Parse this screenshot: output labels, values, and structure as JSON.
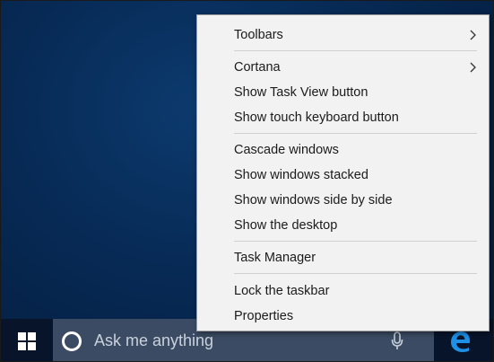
{
  "taskbar": {
    "start_icon": "windows-logo-icon",
    "search": {
      "icon": "cortana-icon",
      "placeholder": "Ask me anything",
      "mic_icon": "microphone-icon"
    },
    "pinned": [
      {
        "icon": "edge-icon",
        "name": "Microsoft Edge"
      }
    ]
  },
  "context_menu": {
    "groups": [
      [
        {
          "label": "Toolbars",
          "submenu": true
        }
      ],
      [
        {
          "label": "Cortana",
          "submenu": true
        },
        {
          "label": "Show Task View button",
          "submenu": false
        },
        {
          "label": "Show touch keyboard button",
          "submenu": false
        }
      ],
      [
        {
          "label": "Cascade windows",
          "submenu": false
        },
        {
          "label": "Show windows stacked",
          "submenu": false
        },
        {
          "label": "Show windows side by side",
          "submenu": false
        },
        {
          "label": "Show the desktop",
          "submenu": false
        }
      ],
      [
        {
          "label": "Task Manager",
          "submenu": false
        }
      ],
      [
        {
          "label": "Lock the taskbar",
          "submenu": false
        },
        {
          "label": "Properties",
          "submenu": false
        }
      ]
    ]
  },
  "colors": {
    "desktop_background": "#072a55",
    "taskbar_background": "#08142a",
    "search_background": "#3b4b63",
    "edge_blue": "#1e90e6",
    "menu_background": "#f2f2f2"
  }
}
